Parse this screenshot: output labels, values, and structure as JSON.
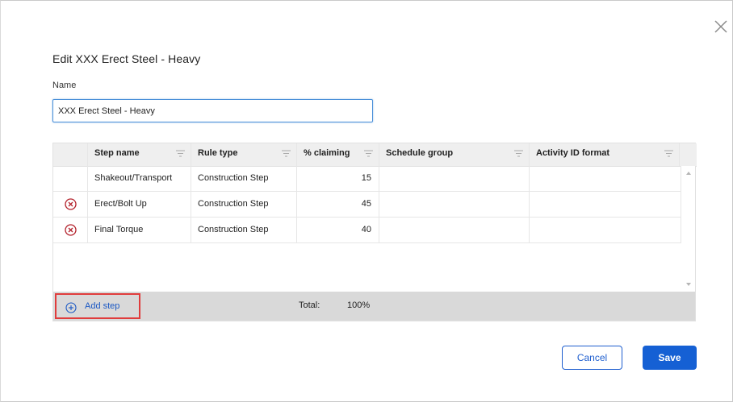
{
  "dialog": {
    "title": "Edit XXX Erect Steel - Heavy",
    "name_label": "Name",
    "name_value": "XXX Erect Steel - Heavy"
  },
  "grid": {
    "columns": [
      "Step name",
      "Rule type",
      "% claiming",
      "Schedule group",
      "Activity ID format"
    ],
    "rows": [
      {
        "step_name": "Shakeout/Transport",
        "rule_type": "Construction Step",
        "claiming": "15",
        "schedule_group": "",
        "activity_id_format": "",
        "removable": false
      },
      {
        "step_name": "Erect/Bolt Up",
        "rule_type": "Construction Step",
        "claiming": "45",
        "schedule_group": "",
        "activity_id_format": "",
        "removable": true
      },
      {
        "step_name": "Final Torque",
        "rule_type": "Construction Step",
        "claiming": "40",
        "schedule_group": "",
        "activity_id_format": "",
        "removable": true
      }
    ],
    "footer": {
      "add_step_label": "Add step",
      "total_label": "Total:",
      "total_value": "100%"
    }
  },
  "buttons": {
    "cancel": "Cancel",
    "save": "Save"
  },
  "icons": {
    "close": "close-icon",
    "filter": "filter-icon",
    "remove": "remove-circle-icon",
    "add": "add-circle-icon"
  },
  "colors": {
    "accent": "#1560d4",
    "link": "#1b58c4",
    "highlight_border": "#e03c3c",
    "remove_icon": "#b3202a"
  }
}
